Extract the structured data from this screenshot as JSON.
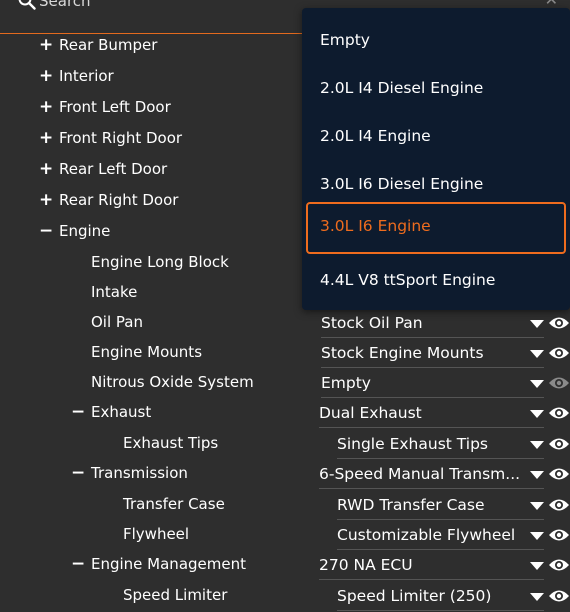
{
  "search": {
    "placeholder": "Search"
  },
  "tree": {
    "rear_bumper": "Rear Bumper",
    "interior": "Interior",
    "front_left_door": "Front Left Door",
    "front_right_door": "Front Right Door",
    "rear_left_door": "Rear Left Door",
    "rear_right_door": "Rear Right Door",
    "engine": "Engine",
    "engine_long_block": "Engine Long Block",
    "intake": "Intake",
    "oil_pan": "Oil Pan",
    "engine_mounts": "Engine Mounts",
    "nitrous": "Nitrous Oxide System",
    "exhaust": "Exhaust",
    "exhaust_tips": "Exhaust Tips",
    "transmission": "Transmission",
    "transfer_case": "Transfer Case",
    "flywheel": "Flywheel",
    "engine_management": "Engine Management",
    "speed_limiter": "Speed Limiter"
  },
  "values": {
    "oil_pan": "Stock Oil Pan",
    "engine_mounts": "Stock Engine Mounts",
    "nitrous": "Empty",
    "exhaust": "Dual Exhaust",
    "exhaust_tips": "Single Exhaust Tips",
    "transmission": "6-Speed Manual Transm...",
    "transfer_case": "RWD Transfer Case",
    "flywheel": "Customizable Flywheel",
    "engine_management": "270 NA ECU",
    "speed_limiter": "Speed Limiter (250)"
  },
  "dropdown": {
    "items": [
      "Empty",
      "2.0L I4 Diesel Engine",
      "2.0L I4 Engine",
      "3.0L I6 Diesel Engine",
      "3.0L I6 Engine",
      "4.4L V8 ttSport Engine"
    ],
    "selected": "3.0L I6 Engine"
  },
  "colors": {
    "accent": "#ee6c1e",
    "background": "#2e2e2e",
    "dropdown_bg": "#0d1b2e"
  },
  "icons": {
    "visibility": "eye-icon",
    "expand": "plus-icon",
    "collapse": "minus-icon"
  }
}
